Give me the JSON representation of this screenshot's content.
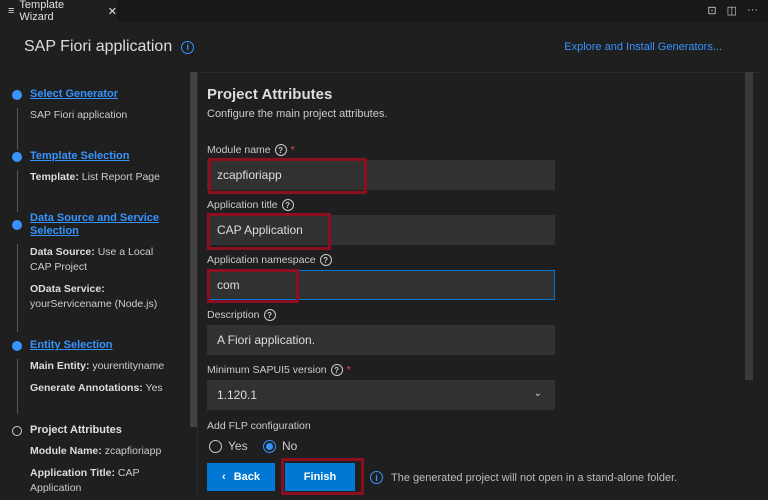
{
  "tab": {
    "title": "Template Wizard"
  },
  "header": {
    "title": "SAP Fiori application",
    "explore_link": "Explore and Install Generators..."
  },
  "sidebar": {
    "steps": [
      {
        "title": "Select Generator",
        "details": [
          {
            "label": "",
            "value": "SAP Fiori application"
          }
        ]
      },
      {
        "title": "Template Selection",
        "details": [
          {
            "label": "Template:",
            "value": "List Report Page"
          }
        ]
      },
      {
        "title": "Data Source and Service Selection",
        "details": [
          {
            "label": "Data Source:",
            "value": "Use a Local CAP Project"
          },
          {
            "label": "OData Service:",
            "value": "yourServicename (Node.js)"
          }
        ]
      },
      {
        "title": "Entity Selection",
        "details": [
          {
            "label": "Main Entity:",
            "value": "yourentityname"
          },
          {
            "label": "Generate Annotations:",
            "value": "Yes"
          }
        ]
      },
      {
        "title": "Project Attributes",
        "details": [
          {
            "label": "Module Name:",
            "value": "zcapfioriapp"
          },
          {
            "label": "Application Title:",
            "value": "CAP Application"
          }
        ]
      }
    ]
  },
  "main": {
    "title": "Project Attributes",
    "subtitle": "Configure the main project attributes.",
    "module_name": {
      "label": "Module name",
      "required": "*",
      "value": "zcapfioriapp"
    },
    "app_title": {
      "label": "Application title",
      "value": "CAP Application"
    },
    "namespace": {
      "label": "Application namespace",
      "value": "com"
    },
    "description": {
      "label": "Description",
      "value": "A Fiori application."
    },
    "ui5": {
      "label": "Minimum SAPUI5 version",
      "required": "*",
      "value": "1.120.1"
    },
    "flp": {
      "label": "Add FLP configuration",
      "yes": "Yes",
      "no": "No",
      "selected": "No"
    }
  },
  "footer": {
    "back": "Back",
    "finish": "Finish",
    "note": "The generated project will not open in a stand-alone folder."
  }
}
